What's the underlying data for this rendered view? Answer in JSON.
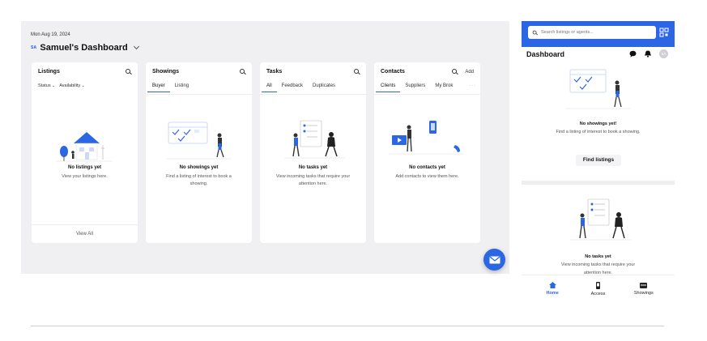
{
  "colors": {
    "accent": "#2b66e5",
    "canvas": "#f0f0f2",
    "card": "#ffffff"
  },
  "desktop": {
    "date": "Mon Aug 19, 2024",
    "initials": "SA",
    "title": "Samuel's Dashboard",
    "cards": {
      "listings": {
        "title": "Listings",
        "filters": [
          "Status",
          "Availability"
        ],
        "empty_title": "No listings yet",
        "empty_desc": "View your listings here.",
        "footer": "View All"
      },
      "showings": {
        "title": "Showings",
        "tabs": [
          "Buyer",
          "Listing"
        ],
        "empty_title": "No showings yet",
        "empty_desc": "Find a listing of interest to book a showing."
      },
      "tasks": {
        "title": "Tasks",
        "tabs": [
          "All",
          "Feedback",
          "Duplicates"
        ],
        "empty_title": "No tasks yet",
        "empty_desc": "View incoming tasks that require your attention here."
      },
      "contacts": {
        "title": "Contacts",
        "add_label": "Add",
        "tabs": [
          "Clients",
          "Suppliers",
          "My Brok"
        ],
        "more": "···",
        "empty_title": "No contacts yet",
        "empty_desc": "Add contacts to view them here."
      }
    },
    "fab_icon": "mail-icon"
  },
  "mobile": {
    "search_placeholder": "Search listings or agents...",
    "title": "Dashboard",
    "avatar_initials": "SA",
    "showings": {
      "empty_title": "No showings yet!",
      "empty_desc": "Find a listing of interest to book a showing.",
      "button": "Find listings"
    },
    "tasks": {
      "empty_title": "No tasks yet",
      "empty_desc": "View incoming tasks that require your attention here."
    },
    "nav": [
      {
        "label": "Home",
        "icon": "home-icon",
        "active": true
      },
      {
        "label": "Access",
        "icon": "phone-icon",
        "active": false
      },
      {
        "label": "Showings",
        "icon": "calendar-icon",
        "active": false
      }
    ]
  }
}
